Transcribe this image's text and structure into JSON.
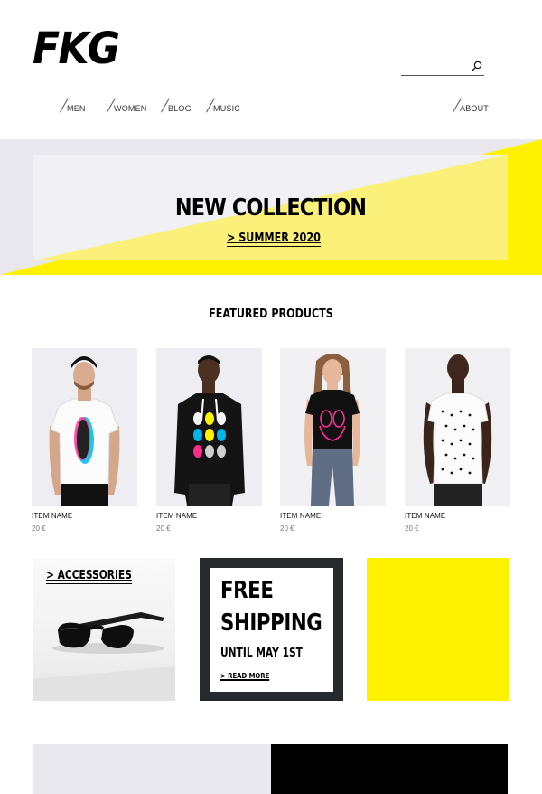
{
  "brand": {
    "logo_text": "FKG"
  },
  "search": {
    "placeholder": "",
    "value": ""
  },
  "nav": {
    "items": [
      {
        "label": "MEN"
      },
      {
        "label": "WOMEN"
      },
      {
        "label": "BLOG"
      },
      {
        "label": "MUSIC"
      }
    ],
    "about_label": "ABOUT"
  },
  "hero": {
    "title": "NEW COLLECTION",
    "subtitle": "> SUMMER 2020"
  },
  "featured": {
    "title": "FEATURED PRODUCTS",
    "products": [
      {
        "name": "ITEM NAME",
        "price": "20 €"
      },
      {
        "name": "ITEM NAME",
        "price": "20 €"
      },
      {
        "name": "ITEM NAME",
        "price": "20 €"
      },
      {
        "name": "ITEM NAME",
        "price": "20 €"
      }
    ]
  },
  "promos": {
    "accessories_label": "> ACCESSORIES",
    "shipping_line1": "FREE",
    "shipping_line2": "SHIPPING",
    "shipping_line3": "UNTIL MAY 1ST",
    "shipping_link": "> READ MORE"
  },
  "colors": {
    "accent_yellow": "#fff200",
    "light_yellow": "#fbf17a",
    "light_gray": "#e8e8ee",
    "dark_frame": "#262a2c"
  }
}
